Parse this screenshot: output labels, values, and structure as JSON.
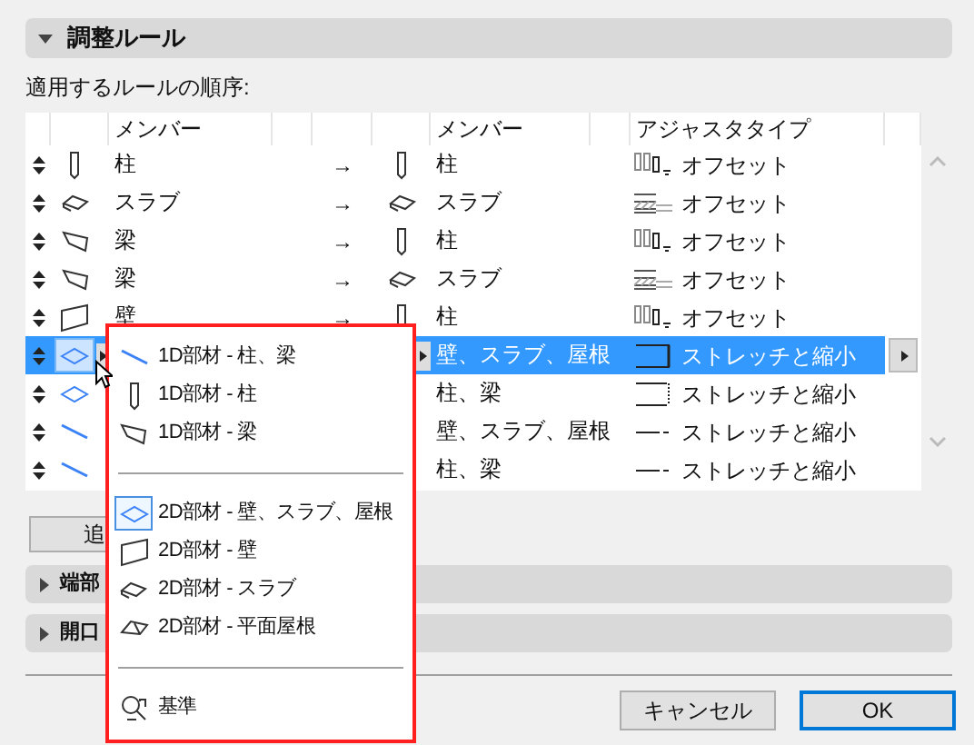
{
  "section": {
    "title": "調整ルール",
    "expanded": true
  },
  "order_label": "適用するルールの順序:",
  "table": {
    "columns": [
      "メンバー",
      "メンバー",
      "アジャスタタイプ"
    ],
    "rows": [
      {
        "selected": false,
        "from_member": "柱",
        "arrow": "→",
        "to_member": "柱",
        "adjust_type": "オフセット"
      },
      {
        "selected": false,
        "from_member": "スラブ",
        "arrow": "→",
        "to_member": "スラブ",
        "adjust_type": "オフセット"
      },
      {
        "selected": false,
        "from_member": "梁",
        "arrow": "→",
        "to_member": "柱",
        "adjust_type": "オフセット"
      },
      {
        "selected": false,
        "from_member": "梁",
        "arrow": "→",
        "to_member": "スラブ",
        "adjust_type": "オフセット"
      },
      {
        "selected": false,
        "from_member": "壁",
        "arrow": "→",
        "to_member": "柱",
        "adjust_type": "オフセット"
      },
      {
        "selected": true,
        "to_member": "壁、スラブ、屋根",
        "adjust_type": "ストレッチと縮小"
      },
      {
        "selected": false,
        "to_member": "柱、梁",
        "adjust_type": "ストレッチと縮小"
      },
      {
        "selected": false,
        "to_member": "壁、スラブ、屋根",
        "adjust_type": "ストレッチと縮小"
      },
      {
        "selected": false,
        "to_member": "柱、梁",
        "adjust_type": "ストレッチと縮小"
      }
    ]
  },
  "add_button": "追",
  "collapsed_sections": [
    {
      "title": "端部",
      "expanded": false
    },
    {
      "title": "開口",
      "expanded": false
    }
  ],
  "popup_menu": [
    {
      "kind": "item",
      "label": "1D部材 - 柱、梁",
      "selected": false
    },
    {
      "kind": "item",
      "label": "1D部材 - 柱",
      "selected": false
    },
    {
      "kind": "item",
      "label": "1D部材 - 梁",
      "selected": false
    },
    {
      "kind": "separator"
    },
    {
      "kind": "item",
      "label": "2D部材 - 壁、スラブ、屋根",
      "selected": true
    },
    {
      "kind": "item",
      "label": "2D部材 - 壁",
      "selected": false
    },
    {
      "kind": "item",
      "label": "2D部材 - スラブ",
      "selected": false
    },
    {
      "kind": "item",
      "label": "2D部材 - 平面屋根",
      "selected": false
    },
    {
      "kind": "separator"
    },
    {
      "kind": "item",
      "label": "基準",
      "selected": false
    }
  ],
  "buttons": [
    {
      "label": "キャンセル",
      "default": false
    },
    {
      "label": "OK",
      "default": true
    }
  ]
}
